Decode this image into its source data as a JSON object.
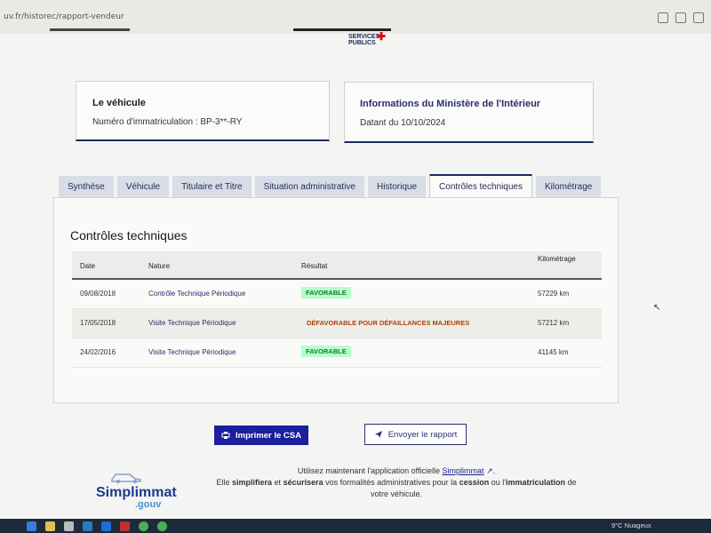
{
  "browser": {
    "url": "uv.fr/historec/rapport-vendeur"
  },
  "header": {
    "logo_line1": "SERVICES",
    "logo_line2": "PUBLICS"
  },
  "vehicle_card": {
    "title": "Le véhicule",
    "value": "Numéro d'immatriculation : BP-3**-RY"
  },
  "info_card": {
    "title": "Informations du Ministère de l'Intérieur",
    "value": "Datant du 10/10/2024"
  },
  "tabs": [
    {
      "label": "Synthèse",
      "active": false
    },
    {
      "label": "Véhicule",
      "active": false
    },
    {
      "label": "Titulaire et Titre",
      "active": false
    },
    {
      "label": "Situation administrative",
      "active": false
    },
    {
      "label": "Historique",
      "active": false
    },
    {
      "label": "Contrôles techniques",
      "active": true
    },
    {
      "label": "Kilométrage",
      "active": false
    }
  ],
  "panel": {
    "title": "Contrôles techniques",
    "columns": {
      "date": "Date",
      "nature": "Nature",
      "result": "Résultat",
      "km": "Kilométrage"
    },
    "rows": [
      {
        "date": "09/08/2018",
        "nature": "Contrôle Technique Périodique",
        "result": "FAVORABLE",
        "status": "ok",
        "km": "57229 km"
      },
      {
        "date": "17/05/2018",
        "nature": "Visite Technique Périodique",
        "result": "DÉFAVORABLE POUR DÉFAILLANCES MAJEURES",
        "status": "ko",
        "km": "57212 km"
      },
      {
        "date": "24/02/2016",
        "nature": "Visite Technique Périodique",
        "result": "FAVORABLE",
        "status": "ok",
        "km": "41145 km"
      }
    ]
  },
  "actions": {
    "print_label": "Imprimer le CSA",
    "send_label": "Envoyer le rapport"
  },
  "promo": {
    "logo_name": "Simplimmat",
    "logo_gouv": ".gouv",
    "line1_pre": "Utilisez maintenant l'application officielle",
    "line1_link": "Simplimmat",
    "line2_a": "Elle",
    "line2_b": "simplifiera",
    "line2_c": "et",
    "line2_d": "sécurisera",
    "line2_e": "vos formalités administratives pour la",
    "line2_f": "cession",
    "line2_g": "ou l'",
    "line2_h": "immatriculation",
    "line2_i": "de",
    "line3": "votre véhicule."
  },
  "taskbar": {
    "weather": "9°C  Nuageux"
  },
  "colors": {
    "accent": "#1b1f9a",
    "favorable_bg": "#b8fec9",
    "favorable_text": "#18753c",
    "defavorable_text": "#b34000"
  }
}
